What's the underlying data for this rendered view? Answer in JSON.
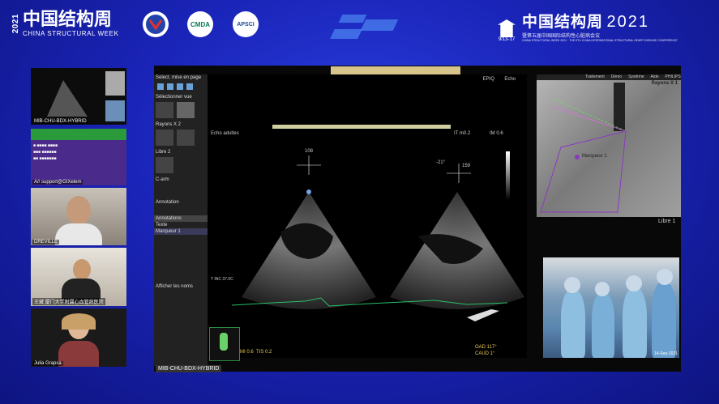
{
  "header": {
    "left_cn": "中国结构周",
    "left_year": "2021",
    "left_en": "CHINA STRUCTURAL WEEK",
    "logos": [
      "",
      "CMDA",
      "APSCI"
    ],
    "right_cn": "中国结构周",
    "right_year": "2021",
    "right_dates": "9/13-17",
    "right_sub_cn": "暨第五届中国国际结构性心脏病会议",
    "right_sub_en": "CHINA STRUCTURAL WEEK 2021 · THE 5TH CHINA INTERNATIONAL STRUCTURAL HEART DISEASE CONFERENCE"
  },
  "thumbnails": [
    {
      "caption": "MIB-CHU-BDX-HYBRID"
    },
    {
      "caption": "A// support@GIXelem"
    },
    {
      "caption": "DREVILLE"
    },
    {
      "caption": "王斌 厦门大学附属心血管病医院"
    },
    {
      "caption": "Julia Grapsa"
    }
  ],
  "echo": {
    "vendor": "EPIQ",
    "mode": "Echo",
    "preset": "Echo adultes",
    "angles": [
      "108",
      "-21°",
      "159"
    ],
    "scale": [
      "IT m0.2",
      "IM 0.6"
    ],
    "bottom": [
      "MI 0.6",
      "TIS 0.2"
    ]
  },
  "sidebar": {
    "items": [
      "Select. mise en page",
      "Sélectionner vue",
      "Rayons X 2",
      "Libre 2",
      "C-arm",
      "Annotation",
      "Annotations",
      "Texte",
      "Marqueur 1",
      "Afficher les noms"
    ]
  },
  "xray": {
    "label": "Rayons X 1",
    "marker": "Marqueur 1",
    "menu": [
      "Traitement",
      "Démo",
      "Système",
      "Aide",
      "PHILIPS"
    ],
    "free": "Libre 1"
  },
  "or": {
    "timestamp": "14-Sep-2021"
  },
  "overlay": {
    "rao": "OAD 117°",
    "caud": "CAUD 1°",
    "bottom_label": "MIB-CHU-BDX-HYBRID"
  }
}
